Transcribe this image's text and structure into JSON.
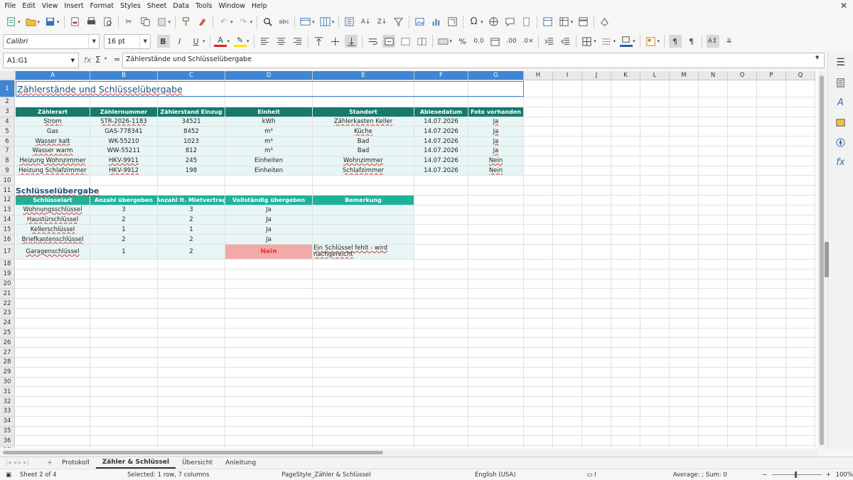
{
  "menu": [
    "File",
    "Edit",
    "View",
    "Insert",
    "Format",
    "Styles",
    "Sheet",
    "Data",
    "Tools",
    "Window",
    "Help"
  ],
  "font": {
    "name": "Calibri",
    "size": "16 pt"
  },
  "name_box": "A1:G1",
  "formula": "Zählerstände und Schlüsselübergabe",
  "columns": [
    "A",
    "B",
    "C",
    "D",
    "E",
    "F",
    "G",
    "H",
    "I",
    "J",
    "K",
    "L",
    "M",
    "N",
    "O",
    "P",
    "Q"
  ],
  "title": "Zählerstände und Schlüsselübergabe",
  "meter_headers": [
    "Zählerart",
    "Zählernummer",
    "Zählerstand Einzug",
    "Einheit",
    "Standort",
    "Ablesedatum",
    "Foto vorhanden"
  ],
  "meters": [
    [
      "Strom",
      "STR-2026-1183",
      "34521",
      "kWh",
      "Zählerkasten Keller",
      "14.07.2026",
      "Ja"
    ],
    [
      "Gas",
      "GAS-778341",
      "8452",
      "m³",
      "Küche",
      "14.07.2026",
      "Ja"
    ],
    [
      "Wasser kalt",
      "WK-55210",
      "1023",
      "m³",
      "Bad",
      "14.07.2026",
      "Ja"
    ],
    [
      "Wasser warm",
      "WW-55211",
      "812",
      "m³",
      "Bad",
      "14.07.2026",
      "Ja"
    ],
    [
      "Heizung Wohnzimmer",
      "HKV-9911",
      "245",
      "Einheiten",
      "Wohnzimmer",
      "14.07.2026",
      "Nein"
    ],
    [
      "Heizung Schlafzimmer",
      "HKV-9912",
      "198",
      "Einheiten",
      "Schlafzimmer",
      "14.07.2026",
      "Nein"
    ]
  ],
  "keys_title": "Schlüsselübergabe",
  "key_headers": [
    "Schlüsselart",
    "Anzahl übergeben",
    "Anzahl lt. Mietvertrag",
    "Vollständig übergeben",
    "Bemerkung"
  ],
  "keys": [
    [
      "Wohnungsschlüssel",
      "3",
      "3",
      "Ja",
      ""
    ],
    [
      "Haustürschlüssel",
      "2",
      "2",
      "Ja",
      ""
    ],
    [
      "Kellerschlüssel",
      "1",
      "1",
      "Ja",
      ""
    ],
    [
      "Briefkastenschlüssel",
      "2",
      "2",
      "Ja",
      ""
    ],
    [
      "Garagenschlüssel",
      "1",
      "2",
      "Nein",
      "Ein Schlüssel fehlt - wird nachgereicht"
    ]
  ],
  "tabs": [
    "Protokoll",
    "Zähler & Schlüssel",
    "Übersicht",
    "Anleitung"
  ],
  "active_tab": "Zähler & Schlüssel",
  "status": {
    "sheet": "Sheet 2 of 4",
    "selection": "Selected: 1 row, 7 columns",
    "page_style": "PageStyle_Zähler & Schlüssel",
    "language": "English (USA)",
    "sum": "Average: ; Sum: 0",
    "zoom": "100%"
  }
}
